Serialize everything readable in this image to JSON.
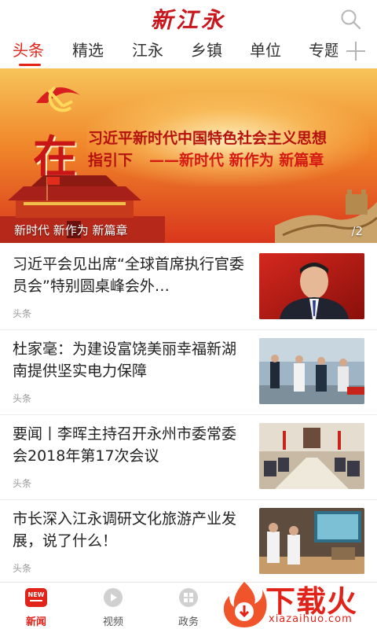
{
  "header": {
    "logo_text": "新江永"
  },
  "tabs": [
    {
      "label": "头条",
      "active": true
    },
    {
      "label": "精选"
    },
    {
      "label": "江永"
    },
    {
      "label": "乡镇"
    },
    {
      "label": "单位"
    },
    {
      "label": "专题"
    }
  ],
  "banner": {
    "big_char": "在",
    "headline_line1": "习近平新时代中国特色社会主义思想",
    "headline_line2a": "指引下",
    "headline_line2b": "——新时代 新作为 新篇章",
    "caption": "新时代 新作为 新篇章",
    "counter": "/2"
  },
  "news": [
    {
      "title": "习近平会见出席“全球首席执行官委员会”特别圆桌峰会外…",
      "tag": "头条"
    },
    {
      "title": "杜家毫：为建设富饶美丽幸福新湖南提供坚实电力保障",
      "tag": "头条"
    },
    {
      "title": "要闻丨李晖主持召开永州市委常委会2018年第17次会议",
      "tag": "头条"
    },
    {
      "title": "市长深入江永调研文化旅游产业发展，说了什么！",
      "tag": "头条"
    }
  ],
  "bottom_nav": [
    {
      "label": "新闻",
      "badge": "NEW",
      "active": true
    },
    {
      "label": "视频"
    },
    {
      "label": "政务"
    }
  ],
  "watermark": {
    "title": "下载火",
    "sub": "xiazaihuo.com"
  },
  "colors": {
    "accent": "#e2231a",
    "tag": "#999999"
  }
}
